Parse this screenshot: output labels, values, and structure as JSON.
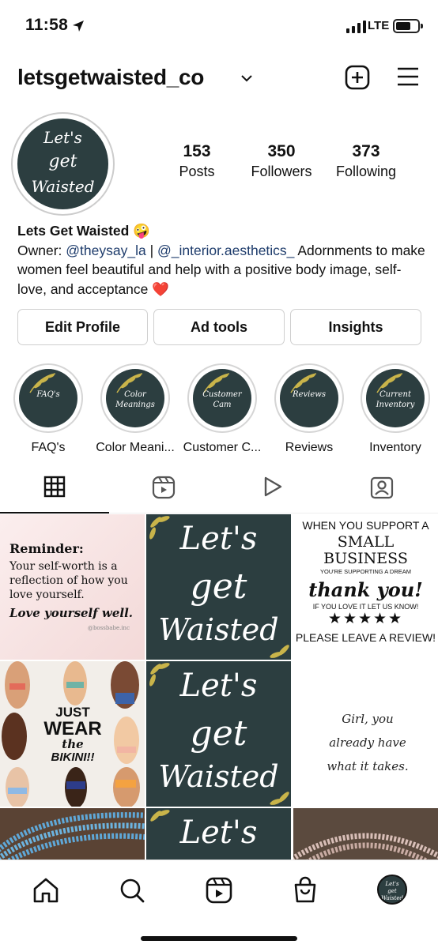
{
  "status_bar": {
    "time": "11:58",
    "network": "LTE"
  },
  "header": {
    "username": "letsgetwaisted_co"
  },
  "avatar": {
    "line1": "Let's",
    "line2": "get",
    "line3": "Waisted"
  },
  "stats": [
    {
      "value": "153",
      "label": "Posts"
    },
    {
      "value": "350",
      "label": "Followers"
    },
    {
      "value": "373",
      "label": "Following"
    }
  ],
  "bio": {
    "name": "Lets Get Waisted 🤪",
    "owner_prefix": "Owner: ",
    "tag1": "@theysay_la",
    "separator": " | ",
    "tag2": "@_interior.aesthetics_",
    "text": " Adornments to make women feel beautiful and help with a positive body image, self-love, and acceptance ❤️"
  },
  "buttons": {
    "edit_profile": "Edit Profile",
    "ad_tools": "Ad tools",
    "insights": "Insights"
  },
  "highlights": [
    {
      "label": "FAQ's",
      "cover": "FAQ's"
    },
    {
      "label": "Color Meani...",
      "cover": "Color Meanings"
    },
    {
      "label": "Customer C...",
      "cover": "Customer Cam"
    },
    {
      "label": "Reviews",
      "cover": "Reviews"
    },
    {
      "label": "Inventory",
      "cover": "Current Inventory"
    }
  ],
  "posts": {
    "reminder": {
      "title": "Reminder:",
      "body": "Your self-worth is a reflection of how you love yourself.",
      "emphasis": "Love yourself well.",
      "credit": "@bossbabe.inc"
    },
    "logo": {
      "line1": "Let's",
      "line2": "get",
      "line3": "Waisted"
    },
    "thankyou": {
      "line1": "WHEN YOU SUPPORT A",
      "line2": "SMALL",
      "line3": "BUSINESS",
      "line4": "YOU'RE SUPPORTING A DREAM",
      "line5": "thank you!",
      "line6": "IF YOU LOVE IT LET US KNOW!",
      "stars": "★★★★★",
      "line7": "PLEASE LEAVE A REVIEW!"
    },
    "bikini": {
      "line1": "JUST",
      "line2": "WEAR",
      "line3": "the",
      "line4": "BIKINI!!"
    },
    "quote": {
      "text": "Girl, you already have what it takes."
    },
    "logo_partial": "Let's"
  },
  "colors": {
    "brand_dark": "#2c3e40",
    "link": "#1d3b6b",
    "gold": "#c9b44a"
  }
}
